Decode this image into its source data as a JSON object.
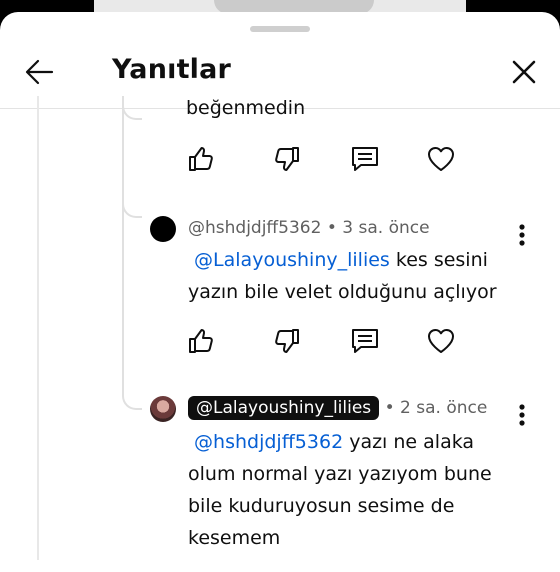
{
  "header": {
    "title": "Yanıtlar"
  },
  "clipped_text": "beğenmedin",
  "comments": [
    {
      "author": "@hshdjdjff5362",
      "time": "3 sa. önce",
      "mention": "@Lalayoushiny_lilies",
      "line1_rest": " kes sesini",
      "line2": "yazın bile velet olduğunu açlıyor"
    },
    {
      "author": "@Lalayoushiny_lilies",
      "time": "2 sa. önce",
      "mention": "@hshdjdjff5362",
      "line1_rest": " yazı ne alaka",
      "line2": "olum normal yazı yazıyom bune",
      "line3": "bile kuduruyosun sesime de",
      "line4": "kesemem"
    }
  ],
  "colors": {
    "mention": "#065fd4",
    "meta": "#606060",
    "chip_bg": "#0f0f0f"
  },
  "icons": [
    "back-arrow-icon",
    "close-icon",
    "like-icon",
    "dislike-icon",
    "reply-icon",
    "heart-icon",
    "more-vert-icon"
  ]
}
